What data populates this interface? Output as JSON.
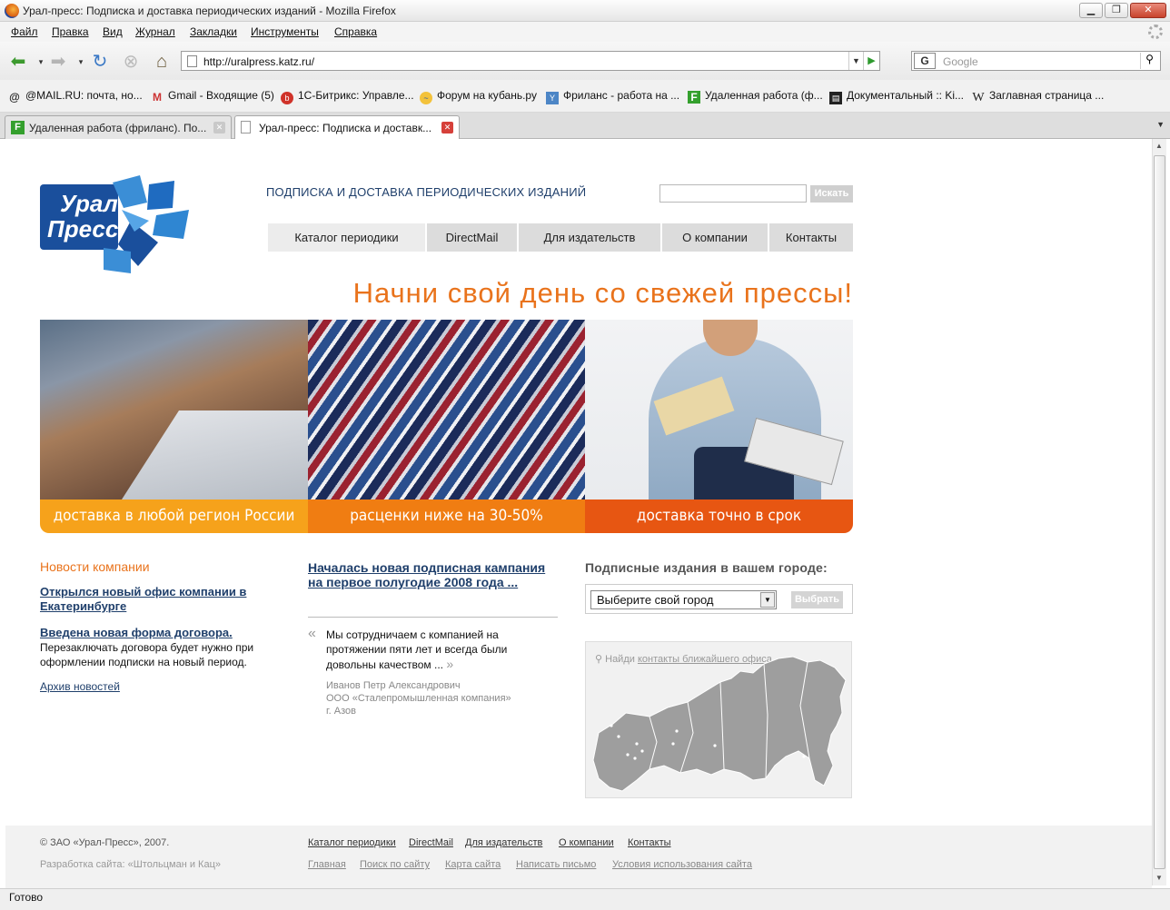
{
  "window": {
    "title": "Урал-пресс: Подписка и доставка периодических изданий - Mozilla Firefox"
  },
  "menu": [
    "Файл",
    "Правка",
    "Вид",
    "Журнал",
    "Закладки",
    "Инструменты",
    "Справка"
  ],
  "navbar": {
    "url": "http://uralpress.katz.ru/",
    "search_placeholder": "Google"
  },
  "bookmarks": [
    "@MAIL.RU: почта, но...",
    "Gmail - Входящие (5)",
    "1С-Битрикс: Управле...",
    "Форум на кубань.ру",
    "Фриланс - работа на ...",
    "Удаленная работа (ф...",
    "Документальный :: Ki...",
    "Заглавная страница ..."
  ],
  "tabs": [
    {
      "label": "Удаленная работа (фриланс). По..."
    },
    {
      "label": "Урал-пресс: Подписка и доставк..."
    }
  ],
  "site": {
    "logo_text": [
      "Урал",
      "Пресс"
    ],
    "tagline": "ПОДПИСКА И ДОСТАВКА ПЕРИОДИЧЕСКИХ ИЗДАНИЙ",
    "search_button": "Искать",
    "nav": [
      "Каталог периодики",
      "DirectMail",
      "Для издательств",
      "О компании",
      "Контакты"
    ],
    "slogan": "Начни свой день со свежей прессы!",
    "captions": [
      "доставка в любой регион России",
      "расценки ниже на 30-50%",
      "доставка точно в срок"
    ],
    "news": {
      "heading": "Новости компании",
      "item1": "Открылся новый офис компании в Екатеринбурге",
      "item2": "Введена новая форма договора.",
      "item2_text": "Перезаключать договора будет нужно при оформлении подписки на новый период.",
      "archive": "Архив новостей"
    },
    "campaign": "Началась новая подписная кампания на первое полугодие 2008 года ...",
    "testimonial": {
      "open": "«",
      "text": "Мы сотрудничаем с компанией на протяжении пяти лет и всегда были довольны качеством ...",
      "close": "»",
      "author": "Иванов Петр Александрович",
      "company": "ООО «Сталепромышленная компания»",
      "city": "г. Азов"
    },
    "city": {
      "heading": "Подписные издания в вашем городе:",
      "select": "Выберите свой город",
      "button": "Выбрать",
      "map_hint_prefix": "Найди",
      "map_hint_link": "контакты ближайшего офиса"
    },
    "footer": {
      "copyright": "© ЗАО «Урал-Пресс», 2007.",
      "developer": "Разработка сайта: «Штольцман и Кац»",
      "links1": [
        "Каталог периодики",
        "DirectMail",
        "Для издательств",
        "О компании",
        "Контакты"
      ],
      "links2": [
        "Главная",
        "Поиск по сайту",
        "Карта сайта",
        "Написать письмо",
        "Условия использования сайта"
      ]
    }
  },
  "status": "Готово",
  "colors": {
    "accent": "#e9731c",
    "link": "#1f3f6b",
    "cap1": "#f6a21b",
    "cap2": "#f07d12",
    "cap3": "#e75612",
    "logo": "#1a4f9c"
  }
}
